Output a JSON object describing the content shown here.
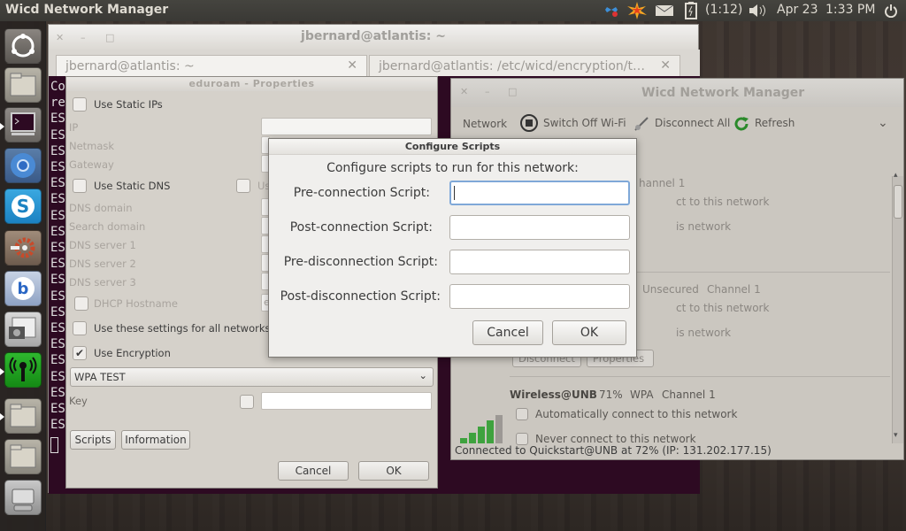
{
  "panel": {
    "app_title": "Wicd Network Manager",
    "battery": "(1:12)",
    "date": "Apr 23",
    "time": "1:33 PM"
  },
  "terminal": {
    "title": "jbernard@atlantis: ~",
    "tabs": [
      "jbernard@atlantis: ~",
      "jbernard@atlantis: /etc/wicd/encryption/t…"
    ],
    "lines": [
      "Co",
      "re",
      "ES",
      "ES",
      "ES",
      "ES",
      "ES",
      "ES",
      "ES",
      "ES",
      "ES",
      "ES",
      "ES",
      "ES",
      "ES",
      "ES",
      "ES",
      "ES",
      "ES",
      "ES",
      "ES",
      "ES"
    ]
  },
  "properties": {
    "title": "eduroam - Properties",
    "use_static_ips": "Use Static IPs",
    "ip": "IP",
    "netmask": "Netmask",
    "gateway": "Gateway",
    "use_static_dns": "Use Static DNS",
    "use_global_partial": "Us",
    "dns_domain": "DNS domain",
    "search_domain": "Search domain",
    "dns1": "DNS server 1",
    "dns2": "DNS server 2",
    "dns3": "DNS server 3",
    "dhcp_hostname": "DHCP Hostname",
    "dhcp_partial": "e",
    "use_for_all": "Use these settings for all networks",
    "use_encryption": "Use Encryption",
    "encryption_type": "WPA TEST",
    "key": "Key",
    "scripts_btn": "Scripts",
    "information_btn": "Information",
    "cancel": "Cancel",
    "ok": "OK"
  },
  "wicd": {
    "title": "Wicd Network Manager",
    "toolbar": {
      "network": "Network",
      "switch_off": "Switch Off Wi-Fi",
      "disconnect_all": "Disconnect All",
      "refresh": "Refresh"
    },
    "net1": {
      "channel": "hannel 1",
      "auto": "ct to this network",
      "never": "is network"
    },
    "net2": {
      "security": "Unsecured",
      "channel": "Channel 1",
      "auto": "ct to this network",
      "never": "is network",
      "disconnect_btn": "Disconnect",
      "properties_btn": "Properties"
    },
    "net3": {
      "name": "Wireless@UNB",
      "signal": "71%",
      "security": "WPA",
      "channel": "Channel 1",
      "auto": "Automatically connect to this network",
      "never": "Never connect to this network"
    },
    "status": "Connected to Quickstart@UNB at 72% (IP: 131.202.177.15)"
  },
  "configure": {
    "title": "Configure Scripts",
    "heading": "Configure scripts to run for this network:",
    "pre_connection": "Pre-connection Script:",
    "post_connection": "Post-connection Script:",
    "pre_disconnection": "Pre-disconnection Script:",
    "post_disconnection": "Post-disconnection Script:",
    "pre_connection_value": "",
    "post_connection_value": "",
    "pre_disconnection_value": "",
    "post_disconnection_value": "",
    "cancel": "Cancel",
    "ok": "OK"
  },
  "launcher_items": [
    "ubuntu-logo-icon",
    "folder-icon",
    "terminal-icon",
    "chromium-icon",
    "skype-icon",
    "settings-icon",
    "bluetooth-icon",
    "screenshot-icon",
    "wicd-icon",
    "folder-icon",
    "folder-icon",
    "drive-icon"
  ]
}
